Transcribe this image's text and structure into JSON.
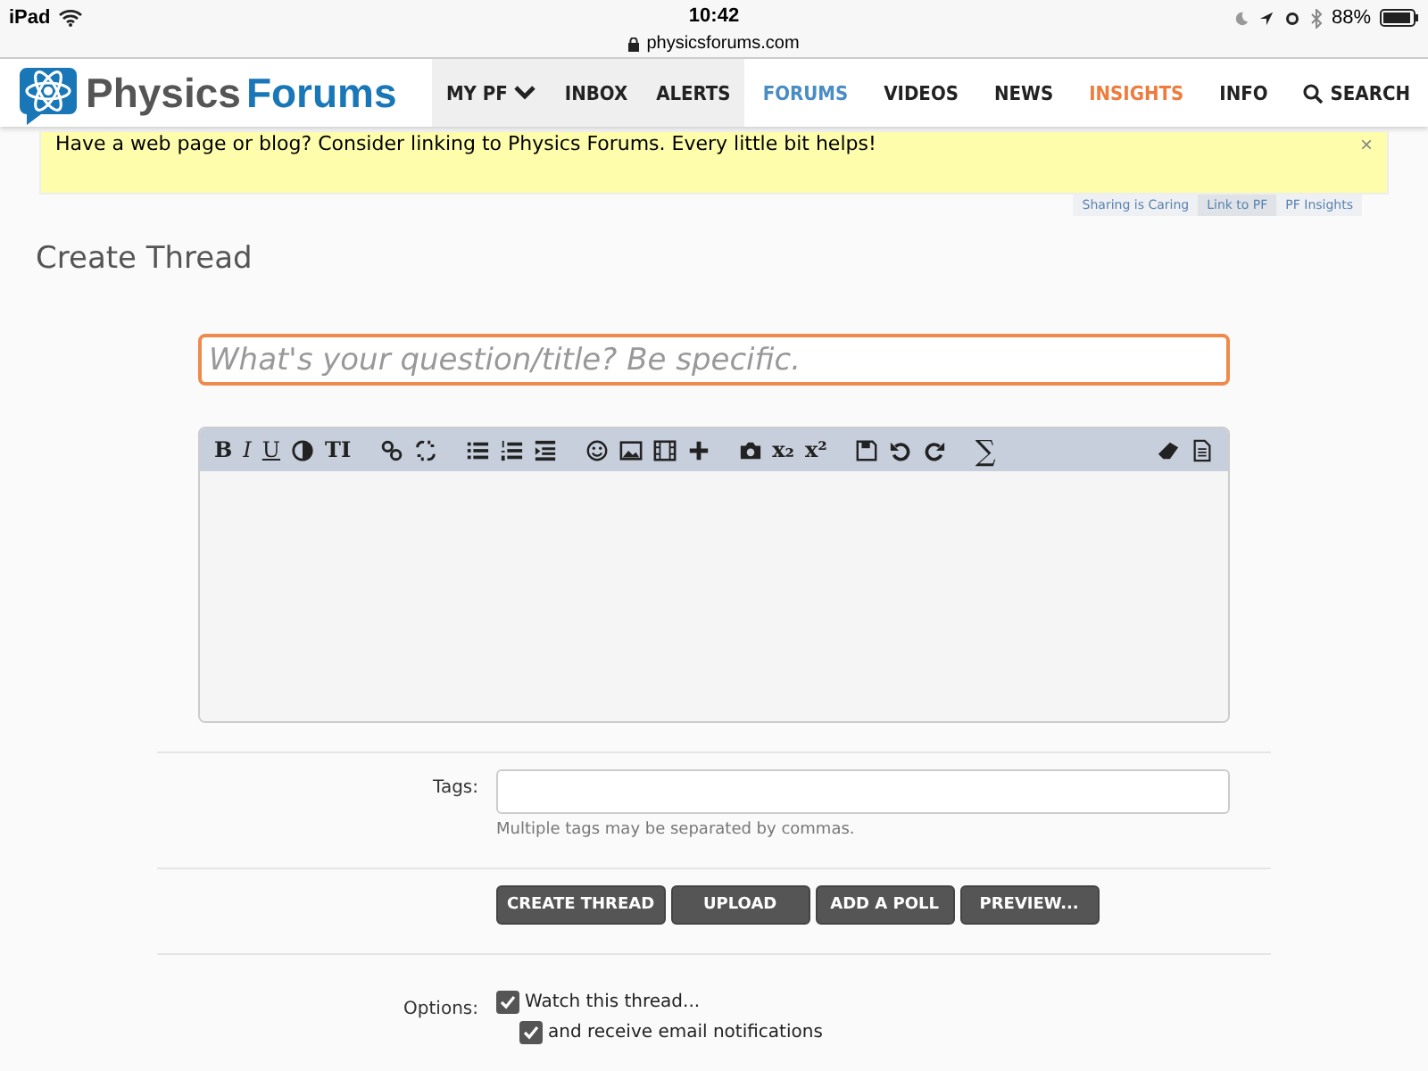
{
  "status_bar": {
    "device": "iPad",
    "time": "10:42",
    "url": "physicsforums.com",
    "battery": "88%"
  },
  "header": {
    "logo_first": "Physics",
    "logo_second": "Forums",
    "nav": [
      {
        "label": "MY PF",
        "kind": "account",
        "selected": false
      },
      {
        "label": "INBOX",
        "kind": "account",
        "selected": false
      },
      {
        "label": "ALERTS",
        "kind": "account",
        "selected": false
      },
      {
        "label": "FORUMS",
        "kind": "section",
        "selected": true
      },
      {
        "label": "VIDEOS",
        "kind": "section",
        "selected": false
      },
      {
        "label": "NEWS",
        "kind": "section",
        "selected": false
      },
      {
        "label": "INSIGHTS",
        "kind": "highlight",
        "selected": false
      },
      {
        "label": "INFO",
        "kind": "section",
        "selected": false
      },
      {
        "label": "SEARCH",
        "kind": "search",
        "selected": false
      }
    ]
  },
  "banner": {
    "text": "Have a web page or blog? Consider linking to Physics Forums. Every little bit helps!",
    "close": "×"
  },
  "share_tabs": [
    {
      "label": "Sharing is Caring",
      "selected": false
    },
    {
      "label": "Link to PF",
      "selected": true
    },
    {
      "label": "PF Insights",
      "selected": false
    }
  ],
  "page_title": "Create Thread",
  "title_field": {
    "placeholder": "What's your question/title? Be specific."
  },
  "editor": {
    "toolbar_labels": [
      "B",
      "I",
      "U",
      "TI",
      "x₂",
      "x²",
      "∑"
    ]
  },
  "tags": {
    "label": "Tags:",
    "hint": "Multiple tags may be separated by commas."
  },
  "buttons": [
    "CREATE THREAD",
    "UPLOAD",
    "ADD A POLL",
    "PREVIEW..."
  ],
  "options": {
    "label": "Options:",
    "items": [
      {
        "label": "Watch this thread...",
        "checked": true
      },
      {
        "label": "and receive email notifications",
        "checked": true
      }
    ]
  }
}
